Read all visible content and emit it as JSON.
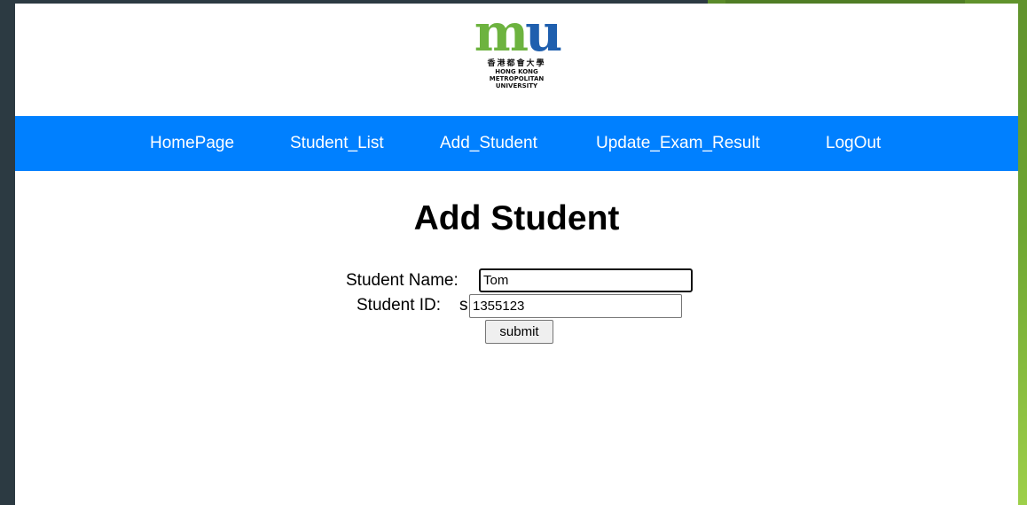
{
  "logo": {
    "mark_left": "m",
    "mark_right": "u",
    "chinese": "香港都會大學",
    "english_line1": "HONG KONG",
    "english_line2": "METROPOLITAN",
    "english_line3": "UNIVERSITY"
  },
  "nav": {
    "items": [
      {
        "label": "HomePage"
      },
      {
        "label": "Student_List"
      },
      {
        "label": "Add_Student"
      },
      {
        "label": "Update_Exam_Result"
      },
      {
        "label": "LogOut"
      }
    ]
  },
  "main": {
    "title": "Add Student",
    "form": {
      "name_label": "Student Name:",
      "name_value": "Tom",
      "id_label": "Student ID:",
      "id_prefix": "s",
      "id_value": "1355123",
      "submit_label": "submit"
    }
  },
  "colors": {
    "navbar": "#0080ff",
    "logo_green": "#6db33f",
    "logo_blue": "#1f5fae",
    "desktop": "#2c3a42"
  }
}
